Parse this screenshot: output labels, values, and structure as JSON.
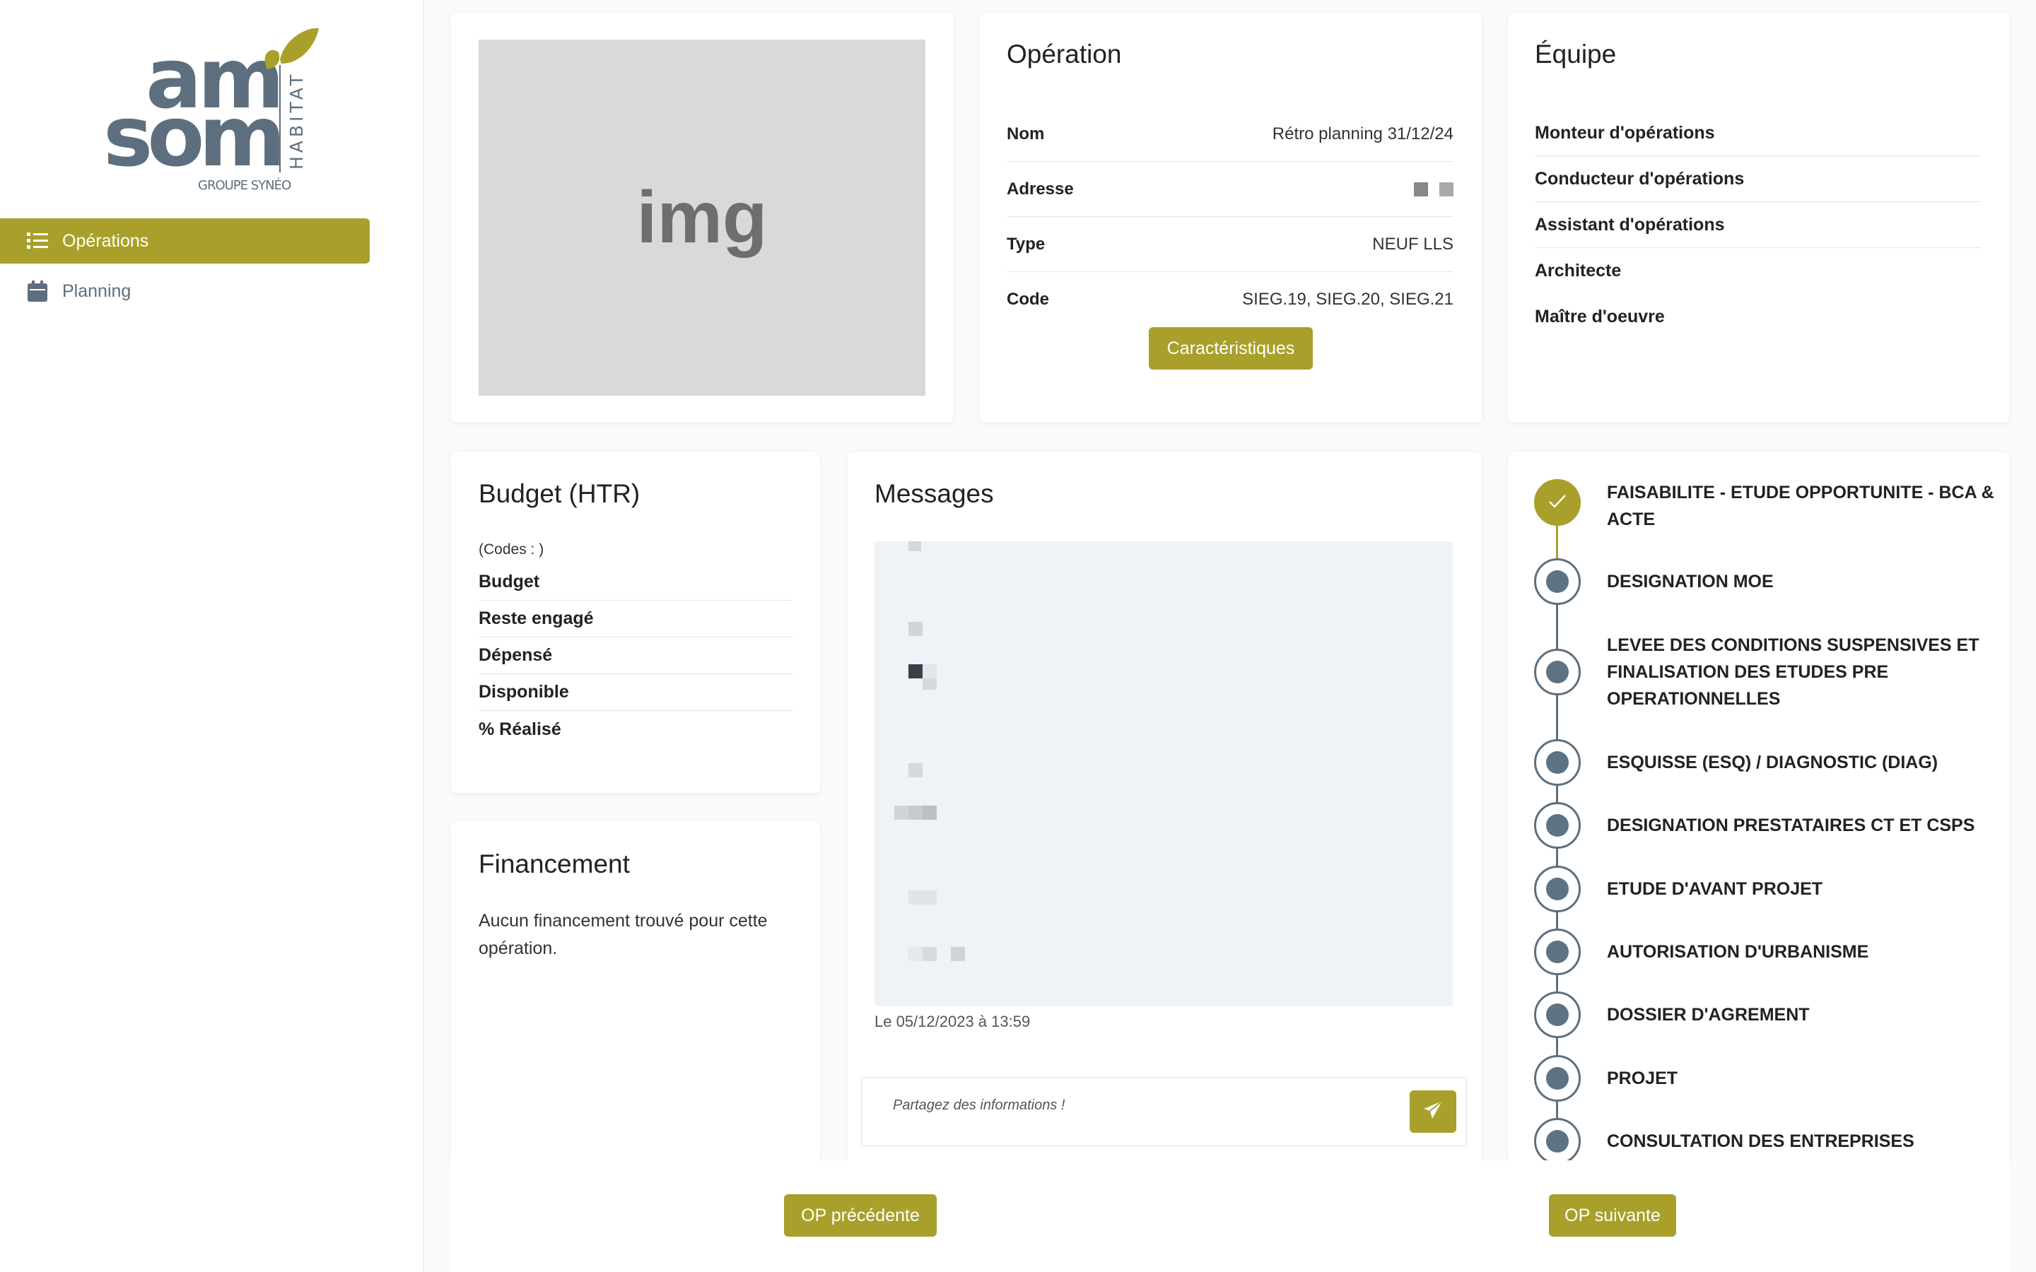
{
  "brand": {
    "logo_letters": [
      "am",
      "som"
    ],
    "logo_vertical": "HABITAT",
    "logo_group": "GROUPE SYNÉO",
    "primary_color": "#a8a02a",
    "slate_color": "#5d6f7e"
  },
  "sidebar": {
    "items": [
      {
        "label": "Opérations",
        "icon": "list-icon",
        "active": true
      },
      {
        "label": "Planning",
        "icon": "calendar-icon",
        "active": false
      }
    ]
  },
  "image_card": {
    "placeholder": "img"
  },
  "operation": {
    "title": "Opération",
    "rows": [
      {
        "key": "Nom",
        "value": "Rétro planning 31/12/24"
      },
      {
        "key": "Adresse",
        "value": ""
      },
      {
        "key": "Type",
        "value": "NEUF LLS"
      },
      {
        "key": "Code",
        "value": "SIEG.19, SIEG.20, SIEG.21"
      }
    ],
    "button_label": "Caractéristiques"
  },
  "team": {
    "title": "Équipe",
    "roles": [
      "Monteur d'opérations",
      "Conducteur d'opérations",
      "Assistant d'opérations",
      "Architecte",
      "Maître d'oeuvre"
    ]
  },
  "budget": {
    "title": "Budget (HTR)",
    "codes": "(Codes : )",
    "rows": [
      "Budget",
      "Reste engagé",
      "Dépensé",
      "Disponible",
      "% Réalisé"
    ]
  },
  "financement": {
    "title": "Financement",
    "empty_text": "Aucun financement trouvé pour cette opération."
  },
  "messages": {
    "title": "Messages",
    "date": "Le 05/12/2023 à 13:59",
    "input_placeholder": "Partagez des informations !"
  },
  "timeline": {
    "steps": [
      {
        "label": "FAISABILITE - ETUDE OPPORTUNITE - BCA & ACTE",
        "done": true
      },
      {
        "label": "DESIGNATION MOE",
        "done": false
      },
      {
        "label": "LEVEE DES CONDITIONS SUSPENSIVES ET FINALISATION DES ETUDES PRE OPERATIONNELLES",
        "done": false
      },
      {
        "label": "ESQUISSE (ESQ) / DIAGNOSTIC (DIAG)",
        "done": false
      },
      {
        "label": "DESIGNATION PRESTATAIRES CT ET CSPS",
        "done": false
      },
      {
        "label": "ETUDE D'AVANT PROJET",
        "done": false
      },
      {
        "label": "AUTORISATION D'URBANISME",
        "done": false
      },
      {
        "label": "DOSSIER D'AGREMENT",
        "done": false
      },
      {
        "label": "PROJET",
        "done": false
      },
      {
        "label": "CONSULTATION DES ENTREPRISES",
        "done": false
      }
    ]
  },
  "navigation": {
    "prev_label": "OP précédente",
    "next_label": "OP suivante"
  }
}
